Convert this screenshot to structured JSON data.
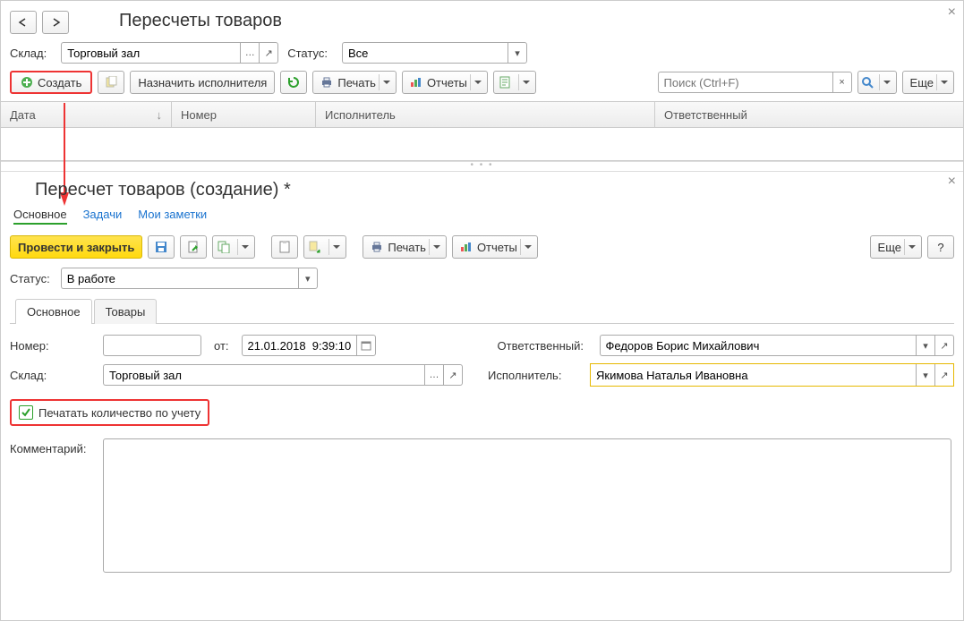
{
  "top": {
    "title": "Пересчеты товаров",
    "filters": {
      "sklad_label": "Склад:",
      "sklad_value": "Торговый зал",
      "status_label": "Статус:",
      "status_value": "Все"
    },
    "toolbar": {
      "create": "Создать",
      "assign_performer": "Назначить исполнителя",
      "print": "Печать",
      "reports": "Отчеты",
      "search_placeholder": "Поиск (Ctrl+F)",
      "more": "Еще"
    },
    "columns": {
      "date": "Дата",
      "number": "Номер",
      "performer": "Исполнитель",
      "responsible": "Ответственный"
    }
  },
  "bottom": {
    "title": "Пересчет товаров (создание) *",
    "nav_tabs": {
      "main": "Основное",
      "tasks": "Задачи",
      "notes": "Мои заметки"
    },
    "toolbar": {
      "post_close": "Провести и закрыть",
      "print": "Печать",
      "reports": "Отчеты",
      "more": "Еще",
      "help": "?"
    },
    "status": {
      "label": "Статус:",
      "value": "В работе"
    },
    "content_tabs": {
      "main": "Основное",
      "goods": "Товары"
    },
    "form": {
      "number_label": "Номер:",
      "number_value": "",
      "from_label": "от:",
      "date_value": "21.01.2018  9:39:10",
      "responsible_label": "Ответственный:",
      "responsible_value": "Федоров Борис Михайлович",
      "sklad_label": "Склад:",
      "sklad_value": "Торговый зал",
      "performer_label": "Исполнитель:",
      "performer_value": "Якимова Наталья Ивановна",
      "print_qty_label": "Печатать количество по учету",
      "comment_label": "Комментарий:",
      "comment_value": ""
    }
  }
}
